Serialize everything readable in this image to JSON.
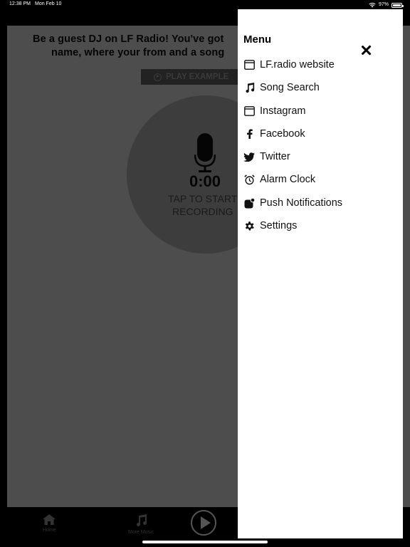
{
  "status_bar": {
    "time": "12:38 PM",
    "date": "Mon Feb 10",
    "battery": "97%"
  },
  "background": {
    "headline_line1": "Be a guest DJ on LF Radio! You've got",
    "headline_line2": "name, where your from and a song",
    "play_example_label": "PLAY EXAMPLE",
    "timer": "0:00",
    "tap_line1": "TAP TO START",
    "tap_line2": "RECORDING"
  },
  "tabbar": {
    "home_label": "Home",
    "more_music_label": "More Music"
  },
  "drawer": {
    "title": "Menu",
    "items": [
      {
        "label": "LF.radio website",
        "icon": "browser-window-icon"
      },
      {
        "label": "Song Search",
        "icon": "music-note-icon"
      },
      {
        "label": "Instagram",
        "icon": "browser-window-icon"
      },
      {
        "label": "Facebook",
        "icon": "facebook-icon"
      },
      {
        "label": "Twitter",
        "icon": "twitter-icon"
      },
      {
        "label": "Alarm Clock",
        "icon": "alarm-clock-icon"
      },
      {
        "label": "Push Notifications",
        "icon": "notification-badge-icon"
      },
      {
        "label": "Settings",
        "icon": "gear-icon"
      }
    ]
  },
  "colors": {
    "drawer_bg": "#ffffff",
    "overlay_bg": "#4d4d4d",
    "text": "#111111"
  }
}
